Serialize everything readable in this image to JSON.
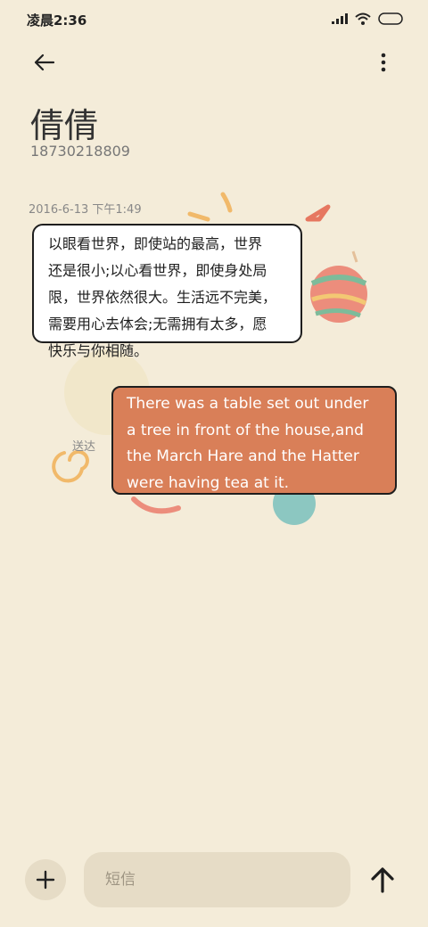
{
  "status_bar": {
    "time": "凌晨2:36"
  },
  "contact": {
    "name": "倩倩",
    "number": "18730218809"
  },
  "conversation": {
    "timestamp": "2016-6-13 下午1:49",
    "incoming": {
      "lines": [
        "以眼看世界，即使站的最高，世界",
        "还是很小;以心看世界，即使身处局",
        "限，世界依然很大。生活远不完美，",
        "需要用心去体会;无需拥有太多，愿",
        "快乐与你相随。"
      ]
    },
    "outgoing": {
      "lines": [
        "There was a table set out under",
        "a tree in front of the house,and",
        "the March Hare and the Hatter",
        "were having tea at it."
      ],
      "status": "送达"
    }
  },
  "composer": {
    "placeholder": "短信"
  },
  "icons": {
    "back": "arrow-left-icon",
    "more": "more-vertical-icon",
    "add": "plus-icon",
    "send": "arrow-up-icon",
    "signal": "signal-icon",
    "wifi": "wifi-icon",
    "battery": "battery-icon"
  },
  "colors": {
    "background": "#f4ecd9",
    "outgoing_bubble": "#d97f58",
    "incoming_bubble": "#ffffff"
  }
}
